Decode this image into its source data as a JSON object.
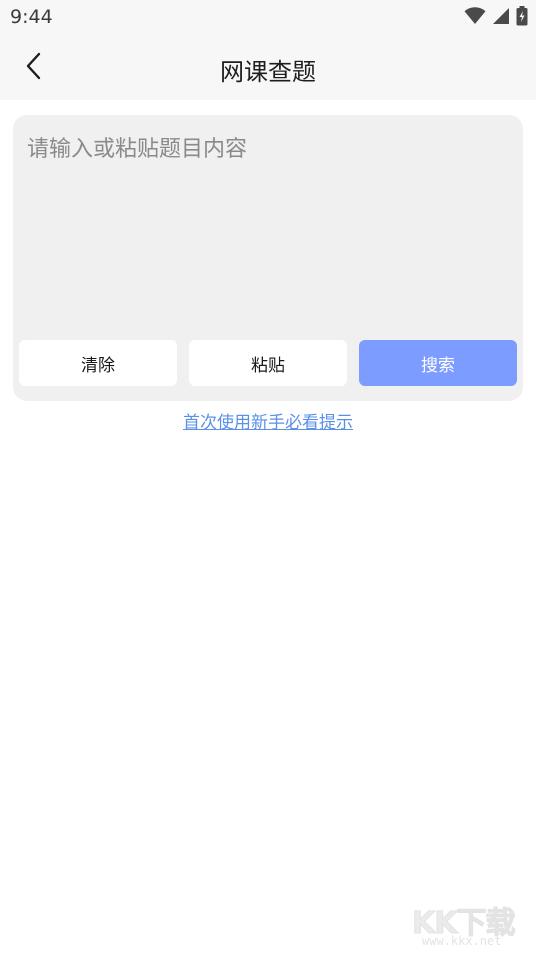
{
  "status_bar": {
    "time": "9:44",
    "icons": [
      "wifi-icon",
      "signal-icon",
      "battery-icon"
    ]
  },
  "header": {
    "back_icon": "chevron-left-icon",
    "title": "网课查题"
  },
  "search": {
    "placeholder": "请输入或粘贴题目内容",
    "value": "",
    "clear_label": "清除",
    "paste_label": "粘贴",
    "search_label": "搜索"
  },
  "tips_link": "首次使用新手必看提示",
  "watermark": {
    "text": "KK下载",
    "url": "www.kkx.net"
  },
  "colors": {
    "accent": "#7c9cff",
    "link": "#5b8fe8",
    "card_bg": "#f0f0f0",
    "header_bg": "#f7f7f7"
  }
}
